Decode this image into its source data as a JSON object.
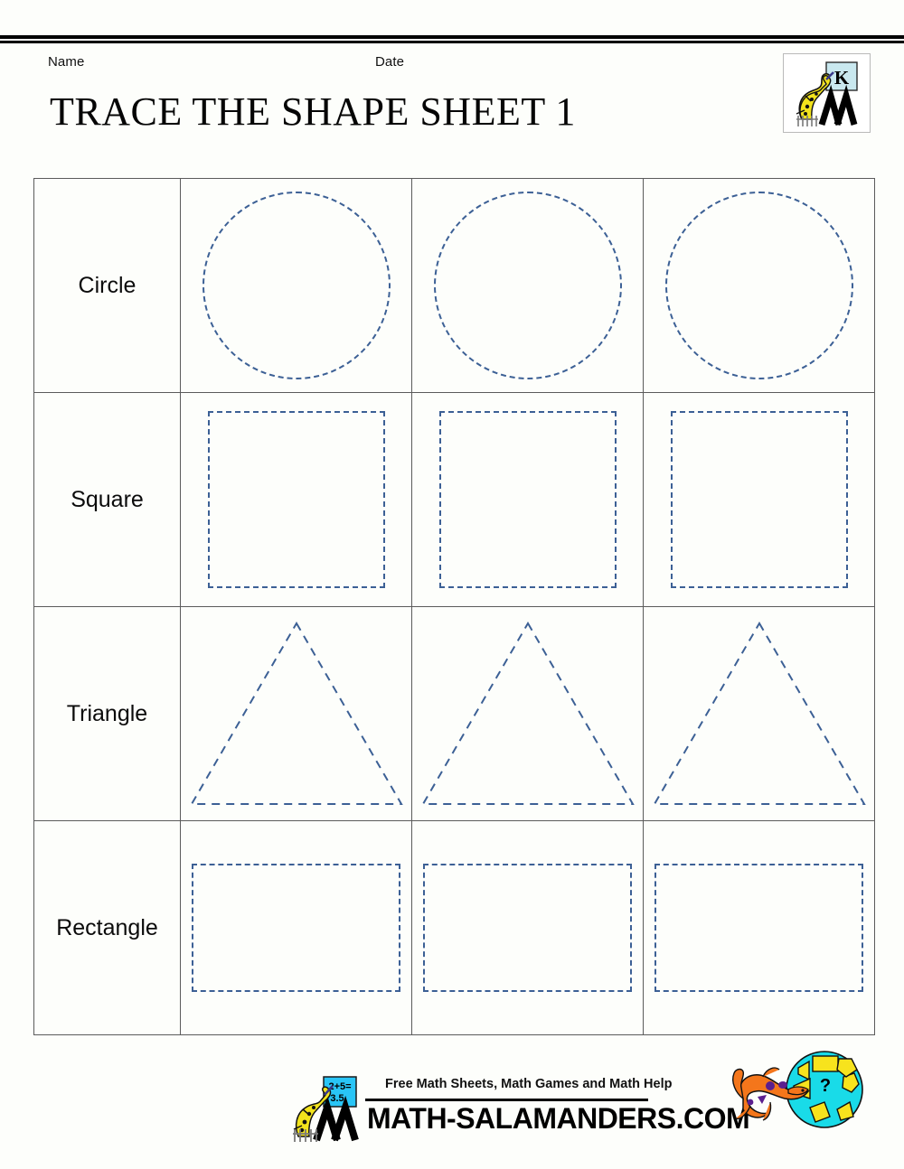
{
  "header": {
    "name_label": "Name",
    "date_label": "Date",
    "title": "TRACE THE SHAPE SHEET 1",
    "logo": {
      "icon": "salamander-chalkboard-logo",
      "board_letter": "K",
      "board_color": "#c9e8ef",
      "mascot_color": "#f2e31c"
    }
  },
  "worksheet": {
    "columns": 3,
    "rows": [
      {
        "label": "Circle",
        "shape": "circle",
        "cells": [
          "circle",
          "circle",
          "circle"
        ]
      },
      {
        "label": "Square",
        "shape": "square",
        "cells": [
          "square",
          "square",
          "square"
        ]
      },
      {
        "label": "Triangle",
        "shape": "triangle",
        "cells": [
          "triangle",
          "triangle",
          "triangle"
        ]
      },
      {
        "label": "Rectangle",
        "shape": "rectangle",
        "cells": [
          "rectangle",
          "rectangle",
          "rectangle"
        ]
      }
    ],
    "trace_color": "#3c6095",
    "grid_color": "#5b5b5b"
  },
  "footer": {
    "tagline": "Free Math Sheets, Math Games and Math Help",
    "url": "MATH-SALAMANDERS.COM",
    "mascot": {
      "icon": "salamander-chalkboard-icon",
      "board_text_top": "2+5=",
      "board_text_bottom": "3.5",
      "board_color": "#29c5f6"
    },
    "corner_graphic": {
      "icon": "salamander-shapes-ball-icon",
      "salamander_color": "#f4761b",
      "spot_color": "#5b1f8f",
      "ball_color": "#19dbe8",
      "shape_color": "#f7e31d",
      "question_mark": "?"
    }
  }
}
